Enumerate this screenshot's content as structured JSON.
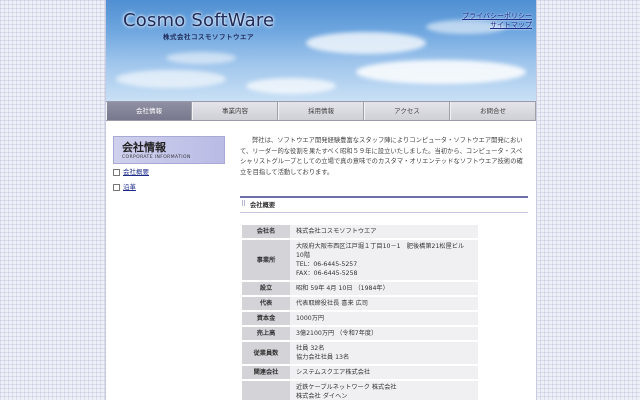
{
  "header": {
    "logo": "Cosmo SoftWare",
    "logo_sub": "株式会社コスモソフトウエア",
    "links": [
      "プライバシーポリシー",
      "サイトマップ"
    ]
  },
  "nav": [
    "会社情報",
    "事業内容",
    "採用情報",
    "アクセス",
    "お問合せ"
  ],
  "sidebar": {
    "title_jp": "会社情報",
    "title_en": "CORPORATE INFORMATION",
    "links": [
      "会社概要",
      "沿革"
    ]
  },
  "intro": "弊社は、ソフトウエア開発経験豊富なスタッフ陣によりコンピュータ・ソフトウエア開発において、リーダー的な役割を果たすべく昭和５９年に設立いたしました。当初から、コンピュータ・スペシャリストグループとしての立場で真の意味でのカスタマ・オリエンテッドなソフトウエア技術の確立を目指して活動しております。",
  "section_title": "会社概要",
  "company": [
    {
      "label": "会社名",
      "lines": [
        "株式会社コスモソフトウエア"
      ]
    },
    {
      "label": "事業所",
      "lines": [
        "大阪府大阪市西区江戸堀１丁目10－1　肥後橋第21松屋ビル10階",
        "TEL：06-6445-5257",
        "FAX：06-6445-5258"
      ]
    },
    {
      "label": "設立",
      "lines": [
        "昭和 59年 4月 10日 （1984年）"
      ]
    },
    {
      "label": "代表",
      "lines": [
        "代表取締役社長 喜来 広司"
      ]
    },
    {
      "label": "資本金",
      "lines": [
        "1000万円"
      ]
    },
    {
      "label": "売上高",
      "lines": [
        "3億2100万円 （令和7年度）"
      ]
    },
    {
      "label": "従業員数",
      "lines": [
        "社員 32名",
        "協力会社社員 13名"
      ]
    },
    {
      "label": "関連会社",
      "lines": [
        "システムスクエア株式会社"
      ]
    },
    {
      "label": "",
      "lines": [
        "近鉄ケーブルネットワーク 株式会社",
        "株式会社 ダイヘン"
      ]
    }
  ]
}
